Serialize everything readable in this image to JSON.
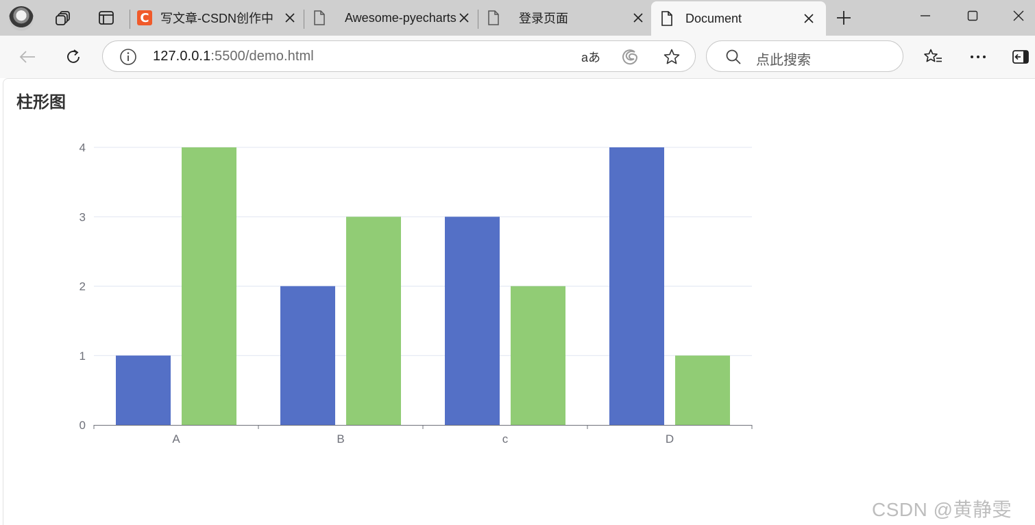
{
  "browser": {
    "tabs": [
      {
        "title": "写文章-CSDN创作中",
        "icon": "csdn-icon",
        "active": false
      },
      {
        "title": "Awesome-pyecharts",
        "icon": "page-icon",
        "active": false
      },
      {
        "title": "登录页面",
        "icon": "page-icon",
        "active": false
      },
      {
        "title": "Document",
        "icon": "page-icon",
        "active": true
      }
    ],
    "csdn_favicon_letter": "C",
    "address": {
      "host": "127.0.0.1",
      "path": ":5500/demo.html"
    },
    "search": {
      "placeholder": "点此搜索"
    },
    "translate_glyph": "aあ"
  },
  "page": {
    "heading": "柱形图",
    "watermark": "CSDN @黄静雯"
  },
  "chart_data": {
    "type": "bar",
    "categories": [
      "A",
      "B",
      "c",
      "D"
    ],
    "series": [
      {
        "values": [
          1,
          2,
          3,
          4
        ],
        "color": "#5470c6"
      },
      {
        "values": [
          4,
          3,
          2,
          1
        ],
        "color": "#91cc75"
      }
    ],
    "ylim": [
      0,
      4
    ],
    "yticks": [
      0,
      1,
      2,
      3,
      4
    ],
    "grid": true,
    "legend": "none"
  }
}
